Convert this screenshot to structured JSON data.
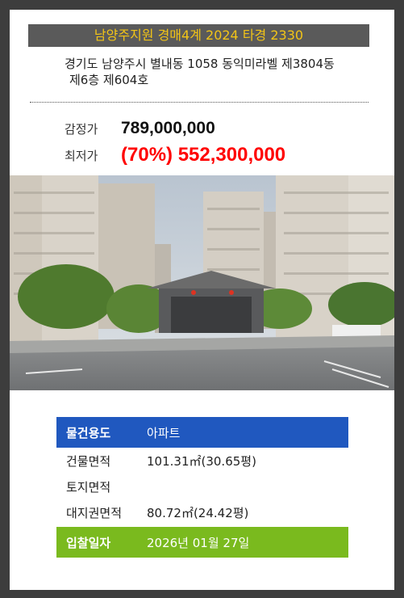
{
  "header": {
    "title": "남양주지원 경매4계 2024 타경 2330"
  },
  "address": {
    "line1": "경기도 남양주시 별내동 1058 동익미라벨 제3804동",
    "line2": "제6층 제604호"
  },
  "prices": {
    "appraisal_label": "감정가",
    "appraisal_value": "789,000,000",
    "minimum_label": "최저가",
    "minimum_value": "(70%) 552,300,000"
  },
  "details": {
    "usage_label": "물건용도",
    "usage_value": "아파트",
    "building_area_label": "건물면적",
    "building_area_value": "101.31㎡(30.65평)",
    "land_area_label": "토지면적",
    "land_area_value": "",
    "land_right_label": "대지권면적",
    "land_right_value": "80.72㎡(24.42평)",
    "bid_date_label": "입찰일자",
    "bid_date_value": "2026년 01월 27일"
  },
  "colors": {
    "title_text": "#f2c417",
    "min_price": "#ff0000",
    "usage_bar": "#2058bf",
    "bid_bar": "#7aba1e"
  }
}
